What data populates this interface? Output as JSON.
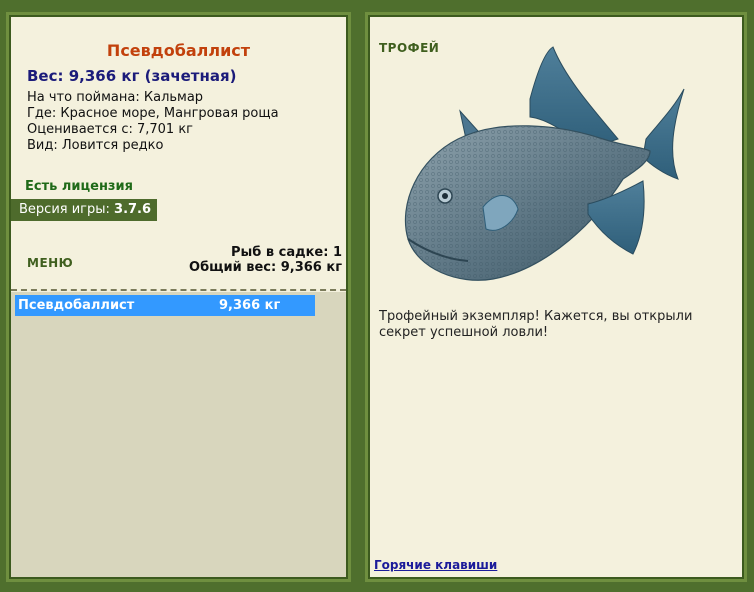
{
  "left": {
    "fish_name": "Псевдобаллист",
    "weight_line": "Вес: 9,366 кг (зачетная)",
    "bait_line": "На что поймана: Кальмар",
    "location_line": "Где: Красное море, Мангровая роща",
    "value_line": "Оценивается с: 7,701 кг",
    "rarity_line": "Вид: Ловится редко",
    "license": "Есть лицензия",
    "version_label": "Версия игры: ",
    "version_value": "3.7.6",
    "menu": "МЕНЮ",
    "fish_in_cage": "Рыб в садке: 1",
    "total_weight": "Общий вес: 9,366 кг",
    "catch_list": [
      {
        "name": "Псевдобаллист",
        "weight": "9,366 кг"
      }
    ]
  },
  "right": {
    "trophy_label": "ТРОФЕЙ",
    "fish_image": "triggerfish-image",
    "trophy_message": "Трофейный экземпляр! Кажется, вы открыли секрет успешной ловли!",
    "hotkeys": "Горячие клавиши"
  },
  "colors": {
    "background": "#4f6f2d",
    "panel": "#f4f1dd",
    "list_bg": "#d8d6bd",
    "selected_row": "#3399ff",
    "fish_name": "#c2410c",
    "weight": "#1b1b7a"
  }
}
